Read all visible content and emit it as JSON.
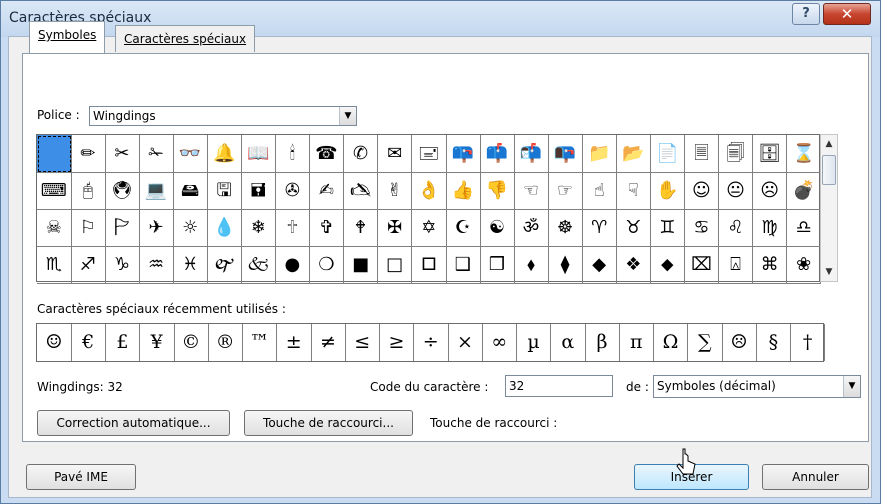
{
  "window": {
    "title": "Caractères spéciaux",
    "help_glyph": "?",
    "close_glyph": "✕"
  },
  "tabs": [
    {
      "label": "Symboles",
      "active": true
    },
    {
      "label": "Caractères spéciaux",
      "active": false
    }
  ],
  "font": {
    "label": "Police :",
    "value": "Wingdings"
  },
  "symbols": [
    [
      "",
      "✏",
      "✂",
      "✁",
      "👓",
      "🔔",
      "📖",
      "🕯",
      "☎",
      "✆",
      "✉",
      "🖃",
      "📪",
      "📫",
      "📬",
      "📭",
      "📁",
      "📂",
      "📄",
      "🗏",
      "🗐",
      "🗄",
      "⌛"
    ],
    [
      "⌨",
      "🖰",
      "🖲",
      "💻",
      "🖴",
      "🖫",
      "🖬",
      "✇",
      "✍",
      "🖎",
      "✌",
      "👌",
      "👍",
      "👎",
      "☜",
      "☞",
      "☝",
      "☟",
      "✋",
      "☺",
      "😐",
      "☹",
      "💣"
    ],
    [
      "☠",
      "⚐",
      "🏱",
      "✈",
      "☼",
      "💧",
      "❄",
      "🕆",
      "✞",
      "🕈",
      "✠",
      "✡",
      "☪",
      "☯",
      "ॐ",
      "☸",
      "♈",
      "♉",
      "♊",
      "♋",
      "♌",
      "♍",
      "♎"
    ],
    [
      "♏",
      "♐",
      "♑",
      "♒",
      "♓",
      "🙰",
      "🙵",
      "●",
      "❍",
      "■",
      "□",
      "🞐",
      "❑",
      "❒",
      "⬧",
      "⧫",
      "◆",
      "❖",
      "⬥",
      "⌧",
      "⍓",
      "⌘",
      "❀"
    ]
  ],
  "recent": {
    "label": "Caractères spéciaux récemment utilisés :",
    "chars": [
      "☺",
      "€",
      "£",
      "¥",
      "©",
      "®",
      "™",
      "±",
      "≠",
      "≤",
      "≥",
      "÷",
      "×",
      "∞",
      "µ",
      "α",
      "β",
      "π",
      "Ω",
      "∑",
      "☹",
      "§",
      "†"
    ]
  },
  "info": {
    "char_name": "Wingdings: 32"
  },
  "code": {
    "label": "Code du caractère :",
    "value": "32"
  },
  "from": {
    "label": "de :",
    "value": "Symboles (décimal)"
  },
  "buttons": {
    "autocorrect": "Correction automatique...",
    "shortcut_key": "Touche de raccourci...",
    "shortcut_label": "Touche de raccourci :",
    "ime": "Pavé IME",
    "insert": "Insérer",
    "cancel": "Annuler"
  },
  "colors": {
    "selected_cell": "#3d8ee6",
    "title_bar": "#c2d7ef",
    "close_button": "#c8462f"
  }
}
